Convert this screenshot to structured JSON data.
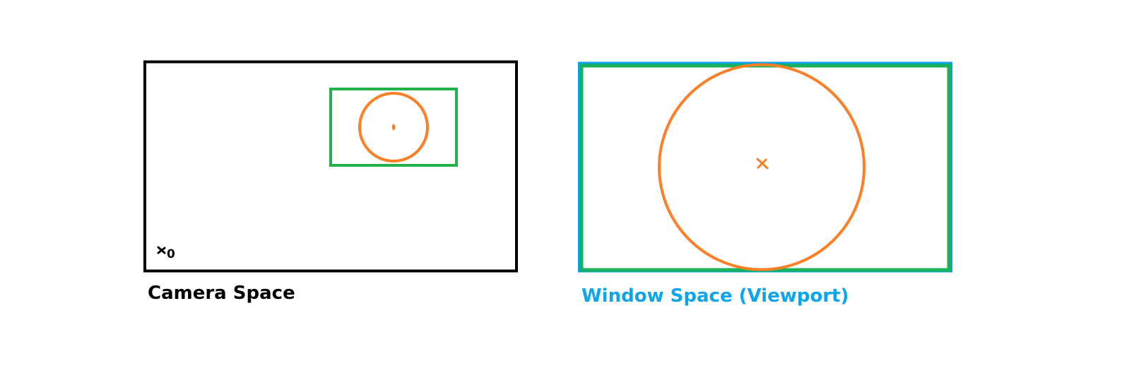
{
  "panels": {
    "camera": {
      "caption": "Camera Space",
      "origin_label": "0"
    },
    "window": {
      "caption": "Window Space (Viewport)"
    }
  },
  "colors": {
    "camera_border": "#000000",
    "viewport_rect": "#22b14c",
    "circle": "#ff7f27",
    "window_caption": "#0ea5e9",
    "window_outer_border": "#00a2e8"
  }
}
